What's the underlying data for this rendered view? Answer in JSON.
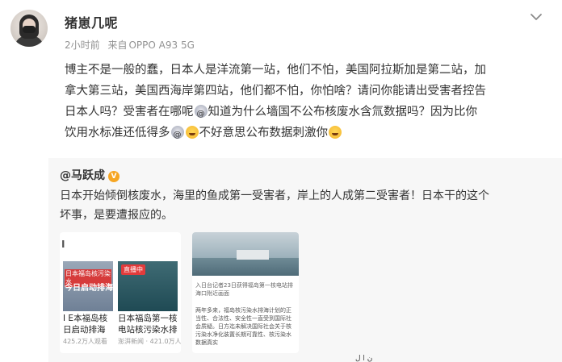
{
  "header": {
    "username": "猪崽几呢",
    "time": "2小时前",
    "source_prefix": "来自",
    "source_device": "OPPO A93 5G"
  },
  "post": {
    "line1": "博主不是一般的蠢，日本人是洋流第一站，他们不怕，美国阿拉斯加是第二站，加",
    "line2": "拿大第三站，美国西海岸第四站，他们都不怕，你怕啥？请问你能请出受害者控告",
    "line3a": "日本人吗？受害者在哪呢",
    "line3b": "知道为什么墙国不公布核废水含氚数据吗？因为比你",
    "line4a": "饮用水标准还低得多",
    "line4b": "不好意思公布数据刺激你",
    "emoji_names": [
      "dizzy-emoji",
      "grin-emoji"
    ]
  },
  "repost": {
    "author": "@马跃成",
    "verified_badge": "V",
    "text_line1": "日本开始倾倒核废水，海里的鱼成第一受害者，岸上的人成第二受害者！日本干的这个",
    "text_line2": "坏事，是要遭报应的。",
    "side_mark": "Ⅰ",
    "video1": {
      "caption_red": "日本福岛核污染水",
      "caption_big": "今日启动排海",
      "title": "Ⅰ E本福岛核日启动排海",
      "views": "425.2万人观看"
    },
    "video2": {
      "live": "直播中",
      "title": "日本福岛第一核电站核污染水排海",
      "views": "澎湃新闻 · 421.0万人看"
    },
    "news": {
      "caption": "入日台记者23日获得福岛第一核电站排海口附近画面",
      "text": "两年多来，福岛核污染水排海计划的正当性、合法性、安全性一直受到国际社会质疑。日方迄未解决国际社会关于核污染水净化装置长期可靠性、核污染水数据真实"
    }
  },
  "footer": {
    "text": "ن ا ل"
  }
}
